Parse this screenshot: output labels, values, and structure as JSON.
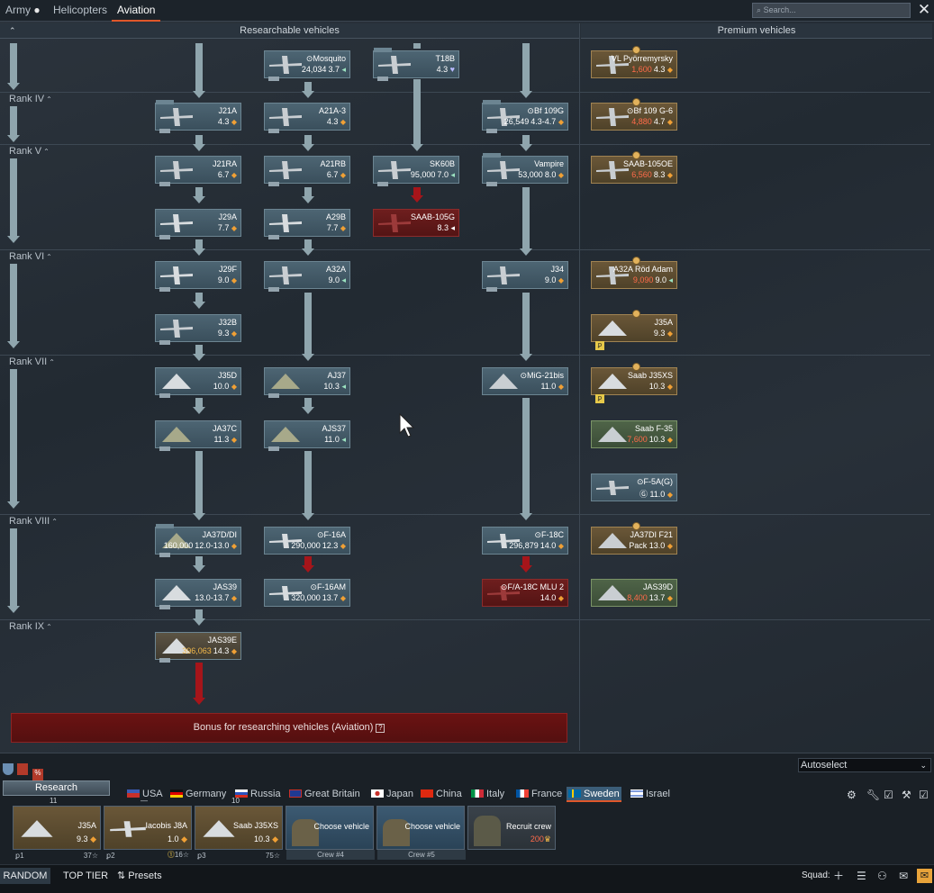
{
  "tabs": {
    "army": "Army",
    "helicopters": "Helicopters",
    "aviation": "Aviation"
  },
  "search": {
    "placeholder": "Search..."
  },
  "close_icon": "close-icon",
  "columns": {
    "researchable": "Researchable vehicles",
    "premium": "Premium vehicles"
  },
  "ranks": [
    "Rank IV",
    "Rank V",
    "Rank VI",
    "Rank VII",
    "Rank VIII",
    "Rank IX"
  ],
  "vehicles": {
    "mosquito": {
      "name": "Mosquito",
      "cost": "24,034",
      "br": "3.7"
    },
    "t18b": {
      "name": "T18B",
      "br": "4.3"
    },
    "vl": {
      "name": "VL Pyörremyrsky",
      "cost": "1,600",
      "br": "4.3"
    },
    "j21a": {
      "name": "J21A",
      "br": "4.3"
    },
    "a21a3": {
      "name": "A21A-3",
      "br": "4.3"
    },
    "bf109g": {
      "name": "Bf 109G",
      "cost": "26,549",
      "br": "4.3-4.7"
    },
    "bf109g6": {
      "name": "Bf 109 G-6",
      "cost": "4,880",
      "br": "4.7"
    },
    "j21ra": {
      "name": "J21RA",
      "br": "6.7"
    },
    "a21rb": {
      "name": "A21RB",
      "br": "6.7"
    },
    "sk60b": {
      "name": "SK60B",
      "cost": "95,000",
      "br": "7.0"
    },
    "vampire": {
      "name": "Vampire",
      "cost": "53,000",
      "br": "8.0"
    },
    "saab105oe": {
      "name": "SAAB-105OE",
      "cost": "6,560",
      "br": "8.3"
    },
    "j29a": {
      "name": "J29A",
      "br": "7.7"
    },
    "a29b": {
      "name": "A29B",
      "br": "7.7"
    },
    "saab105g": {
      "name": "SAAB-105G",
      "br": "8.3"
    },
    "j29f": {
      "name": "J29F",
      "br": "9.0"
    },
    "a32a": {
      "name": "A32A",
      "br": "9.0"
    },
    "j34": {
      "name": "J34",
      "br": "9.0"
    },
    "a32arod": {
      "name": "A32A Röd Adam",
      "cost": "9,090",
      "br": "9.0"
    },
    "j32b": {
      "name": "J32B",
      "br": "9.3"
    },
    "j35a": {
      "name": "J35A",
      "br": "9.3"
    },
    "j35d": {
      "name": "J35D",
      "br": "10.0"
    },
    "aj37": {
      "name": "AJ37",
      "br": "10.3"
    },
    "mig21": {
      "name": "MiG-21bis",
      "br": "11.0"
    },
    "j35xs": {
      "name": "Saab J35XS",
      "br": "10.3"
    },
    "ja37c": {
      "name": "JA37C",
      "br": "11.3"
    },
    "ajs37": {
      "name": "AJS37",
      "br": "11.0"
    },
    "f35": {
      "name": "Saab F-35",
      "cost": "7,600",
      "br": "10.3"
    },
    "f5ag": {
      "name": "F-5A(G)",
      "br": "11.0"
    },
    "ja37ddi": {
      "name": "JA37D/DI",
      "cost": "160,000",
      "br": "12.0-13.0"
    },
    "f16a": {
      "name": "F-16A",
      "cost": "290,000",
      "br": "12.3"
    },
    "f18c": {
      "name": "F-18C",
      "cost": "296,879",
      "br": "14.0"
    },
    "ja37f21": {
      "name": "JA37DI F21",
      "name2": "Pack",
      "br": "13.0"
    },
    "jas39": {
      "name": "JAS39",
      "br": "13.0-13.7"
    },
    "f16am": {
      "name": "F-16AM",
      "cost": "320,000",
      "br": "13.7"
    },
    "fa18c": {
      "name": "F/A-18C MLU 2",
      "br": "14.0"
    },
    "jas39d": {
      "name": "JAS39D",
      "cost": "8,400",
      "br": "13.7"
    },
    "jas39e": {
      "name": "JAS39E",
      "cost": "396,063",
      "br": "14.3"
    }
  },
  "bonus": {
    "text": "Bonus for researching vehicles (Aviation)",
    "help": "?"
  },
  "research_label": "Research",
  "autoselect": "Autoselect",
  "nations": [
    "USA",
    "Germany",
    "Russia",
    "Great Britain",
    "Japan",
    "China",
    "Italy",
    "France",
    "Sweden",
    "Israel"
  ],
  "slots": [
    {
      "name": "J35A",
      "br": "9.3",
      "crew": "1",
      "pts": "37",
      "top": "11"
    },
    {
      "name": "Iacobis J8A",
      "br": "1.0",
      "crew": "2",
      "pts": "16",
      "top": "—"
    },
    {
      "name": "Saab J35XS",
      "br": "10.3",
      "crew": "3",
      "pts": "75",
      "top": "10"
    },
    {
      "name": "Choose vehicle",
      "crew_label": "Crew #4"
    },
    {
      "name": "Choose vehicle",
      "crew_label": "Crew #5"
    },
    {
      "name": "Recruit crew",
      "cost": "200"
    }
  ],
  "bottom": {
    "random": "RANDOM",
    "top_tier": "TOP TIER",
    "presets": "Presets",
    "squad": "Squad:"
  }
}
